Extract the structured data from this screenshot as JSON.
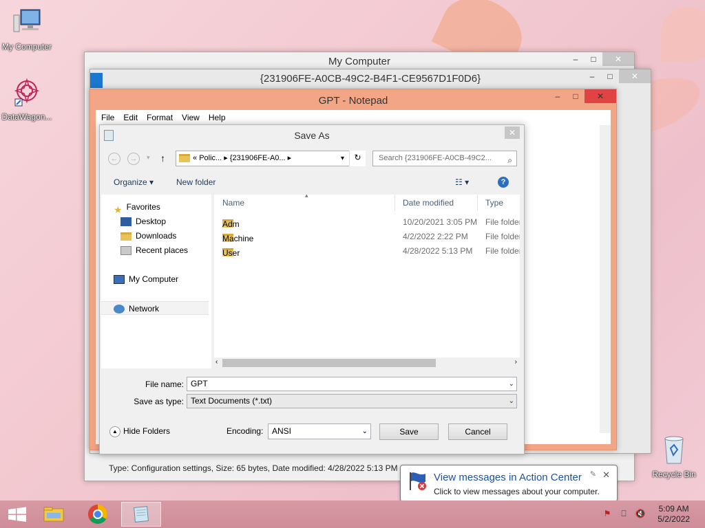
{
  "desktop": {
    "icons": [
      {
        "label": "My Computer"
      },
      {
        "label": "DataWagon..."
      },
      {
        "label": "Recycle Bin"
      }
    ]
  },
  "explorer": {
    "title": "My Computer",
    "status": "Type: Configuration settings, Size: 65 bytes, Date modified: 4/28/2022 5:13 PM"
  },
  "explorer2": {
    "title": "{231906FE-A0CB-49C2-B4F1-CE9567D1F0D6}"
  },
  "notepad": {
    "title": "GPT - Notepad",
    "menu": [
      "File",
      "Edit",
      "Format",
      "View",
      "Help"
    ]
  },
  "save_dialog": {
    "title": "Save As",
    "address": {
      "prefix": "«",
      "crumbs": [
        "Polic...",
        "{231906FE-A0..."
      ]
    },
    "search_placeholder": "Search {231906FE-A0CB-49C2...",
    "toolbar": {
      "organize": "Organize",
      "new_folder": "New folder"
    },
    "nav": {
      "favorites": "Favorites",
      "desktop": "Desktop",
      "downloads": "Downloads",
      "recent": "Recent places",
      "my_computer": "My Computer",
      "network": "Network"
    },
    "columns": {
      "name": "Name",
      "date": "Date modified",
      "type": "Type"
    },
    "files": [
      {
        "name": "Adm",
        "date": "10/20/2021 3:05 PM",
        "type": "File folder"
      },
      {
        "name": "Machine",
        "date": "4/2/2022 2:22 PM",
        "type": "File folder"
      },
      {
        "name": "User",
        "date": "4/28/2022 5:13 PM",
        "type": "File folder"
      }
    ],
    "file_name_label": "File name:",
    "file_name_value": "GPT",
    "save_type_label": "Save as type:",
    "save_type_value": "Text Documents (*.txt)",
    "hide_folders": "Hide Folders",
    "encoding_label": "Encoding:",
    "encoding_value": "ANSI",
    "save_btn": "Save",
    "cancel_btn": "Cancel"
  },
  "balloon": {
    "title": "View messages in Action Center",
    "body": "Click to view messages about your computer."
  },
  "taskbar": {
    "time": "5:09 AM",
    "date": "5/2/2022"
  },
  "colors": {
    "notepad_frame": "#f3a686",
    "close_red": "#e04343",
    "taskbar": "#d79aa4"
  }
}
